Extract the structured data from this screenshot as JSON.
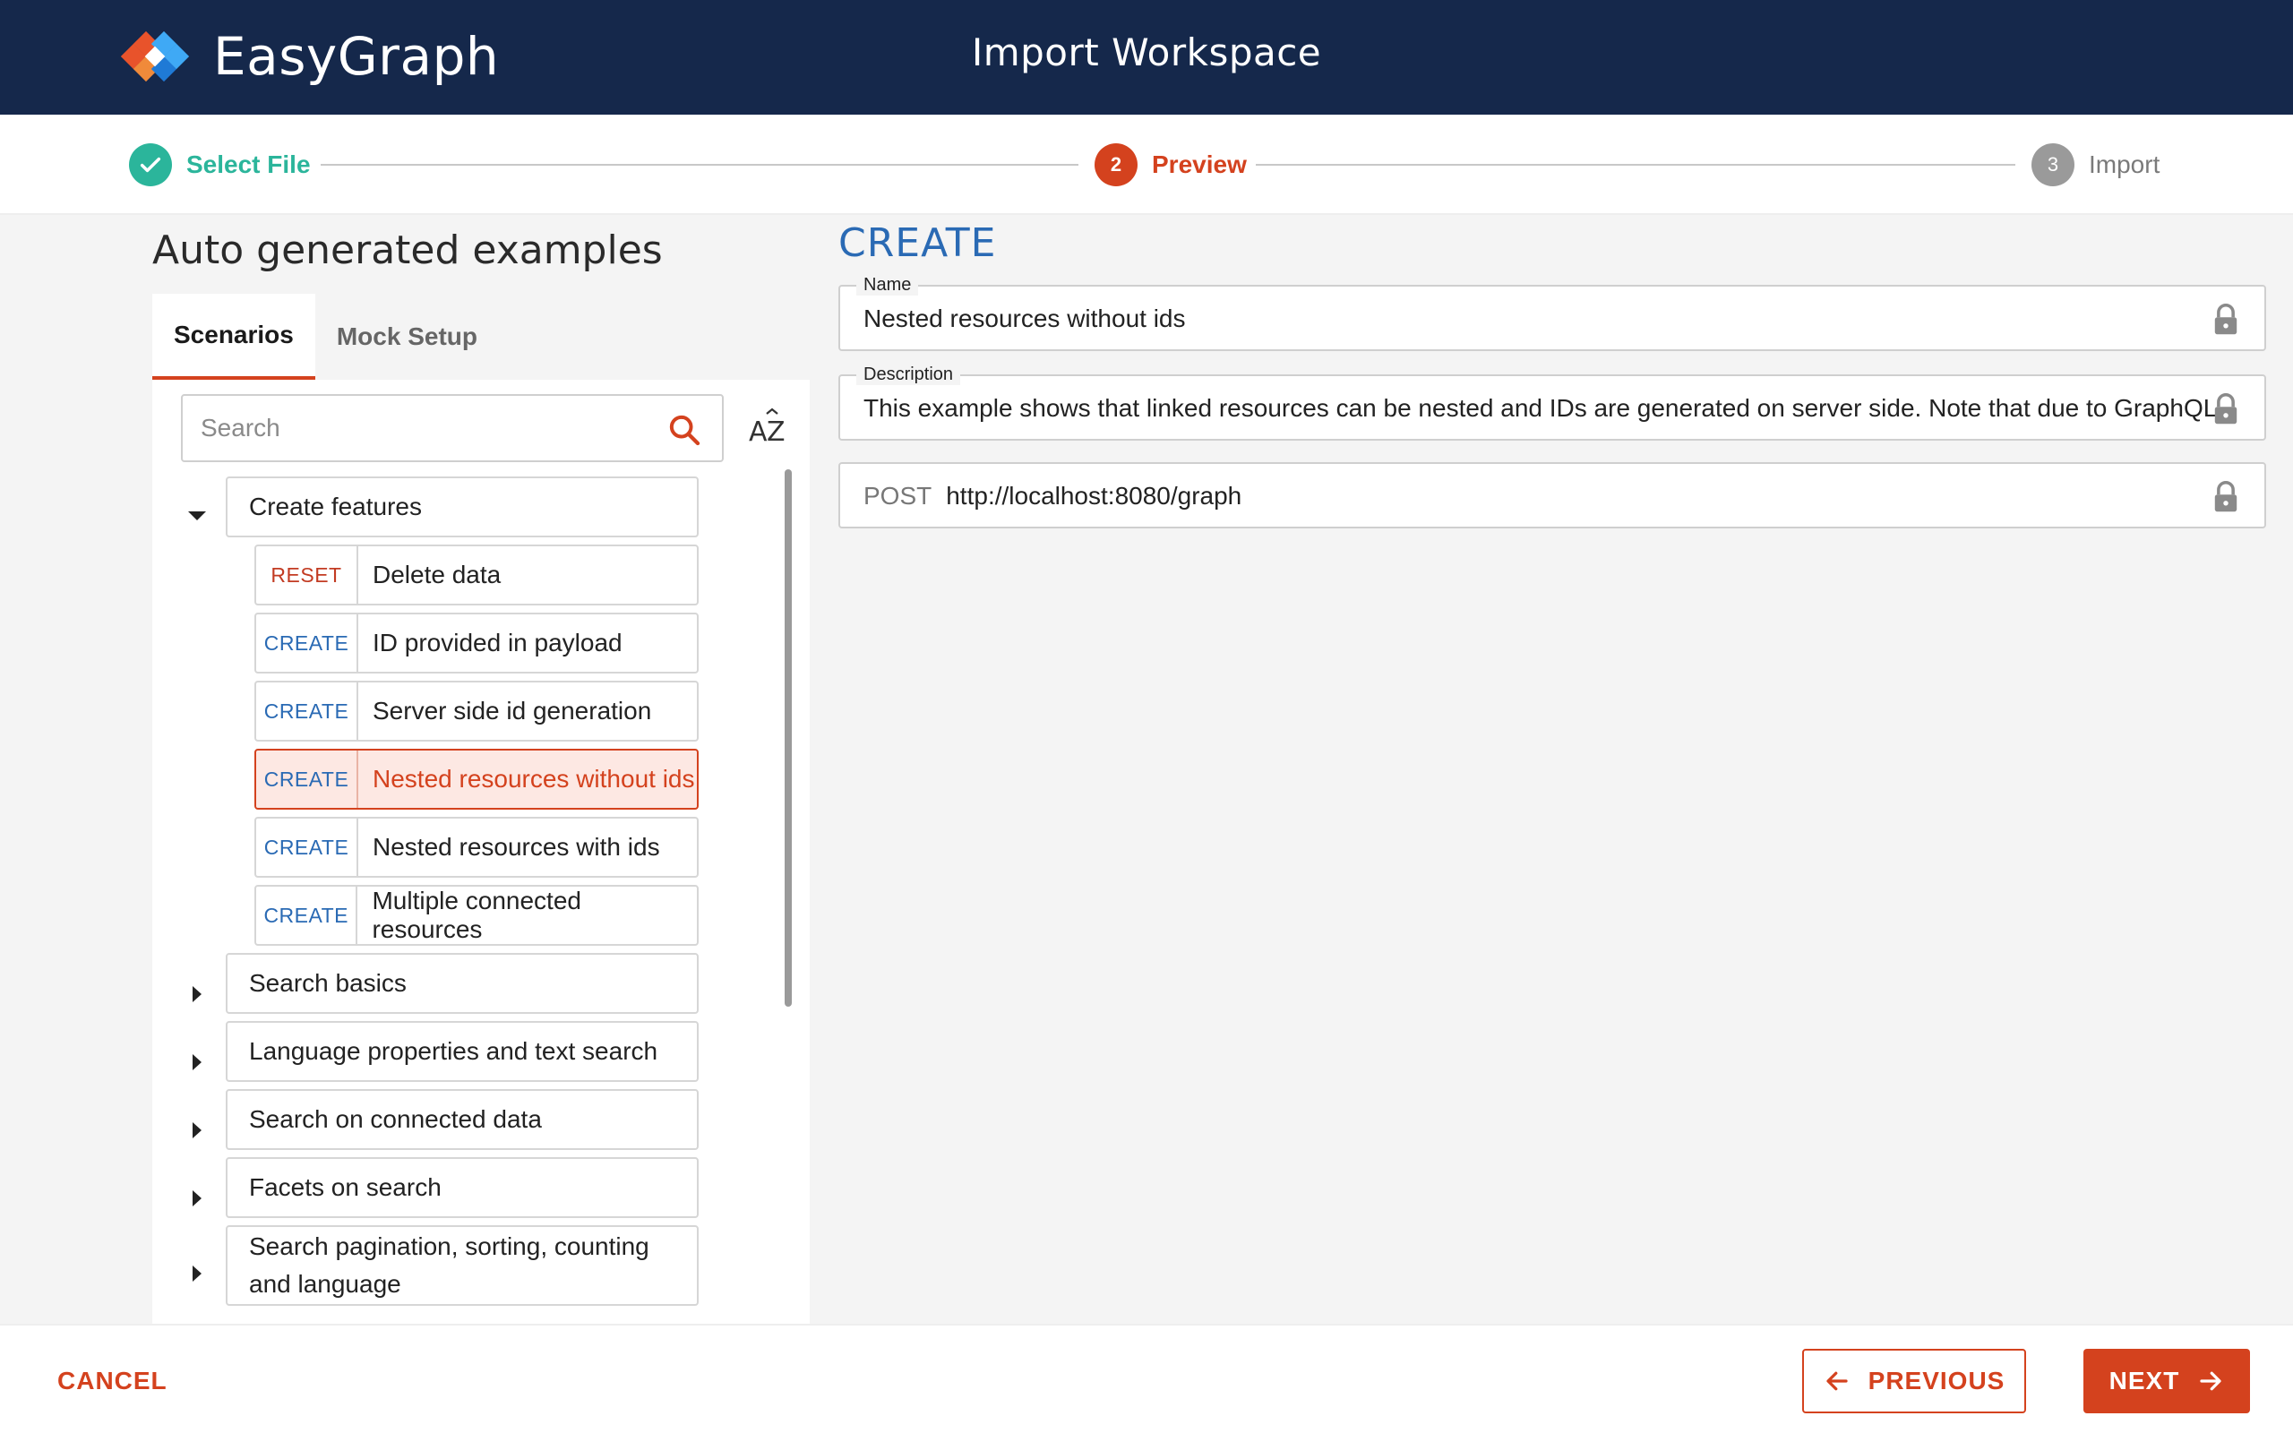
{
  "header": {
    "brand_name": "EasyGraph",
    "page_title": "Import Workspace"
  },
  "stepper": {
    "steps": [
      {
        "number": "1",
        "label": "Select File",
        "status": "completed"
      },
      {
        "number": "2",
        "label": "Preview",
        "status": "active"
      },
      {
        "number": "3",
        "label": "Import",
        "status": "pending"
      }
    ]
  },
  "left_panel": {
    "title": "Auto generated examples",
    "tabs": [
      {
        "label": "Scenarios",
        "active": true
      },
      {
        "label": "Mock Setup",
        "active": false
      }
    ],
    "search": {
      "placeholder": "Search",
      "value": ""
    },
    "sort_icon": "sort-alpha-icon",
    "groups": [
      {
        "label": "Create features",
        "expanded": true,
        "items": [
          {
            "method": "RESET",
            "label": "Delete data",
            "selected": false
          },
          {
            "method": "CREATE",
            "label": "ID provided in payload",
            "selected": false
          },
          {
            "method": "CREATE",
            "label": "Server side id generation",
            "selected": false
          },
          {
            "method": "CREATE",
            "label": "Nested resources without ids",
            "selected": true
          },
          {
            "method": "CREATE",
            "label": "Nested resources with ids",
            "selected": false
          },
          {
            "method": "CREATE",
            "label": "Multiple connected resources",
            "selected": false
          }
        ]
      },
      {
        "label": "Search basics",
        "expanded": false
      },
      {
        "label": "Language properties and text search",
        "expanded": false
      },
      {
        "label": "Search on connected data",
        "expanded": false
      },
      {
        "label": "Facets on search",
        "expanded": false
      },
      {
        "label": "Search pagination, sorting, counting and language",
        "expanded": false
      }
    ]
  },
  "right_panel": {
    "heading": "CREATE",
    "name_field": {
      "label": "Name",
      "value": "Nested resources without ids"
    },
    "description_field": {
      "label": "Description",
      "value": "This example shows that linked resources can be nested and IDs are generated on server side. Note that due to GraphQL"
    },
    "request_field": {
      "method": "POST",
      "url": "http://localhost:8080/graph"
    }
  },
  "footer": {
    "cancel_label": "CANCEL",
    "previous_label": "PREVIOUS",
    "next_label": "NEXT"
  },
  "colors": {
    "header_bg": "#15284b",
    "accent": "#d4421e",
    "success": "#2bb59b",
    "create_method": "#2a6ab4"
  }
}
